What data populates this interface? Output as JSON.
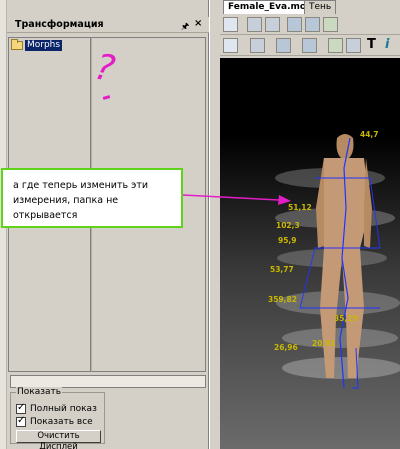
{
  "panel": {
    "title": "Трансформация",
    "pin": "🖈",
    "close": "×",
    "tree": {
      "items": [
        {
          "label": "Morphs",
          "icon": "folder-icon"
        }
      ]
    },
    "show_group": {
      "legend": "Показать",
      "full_label": "Полный показ",
      "full_checked": true,
      "all_label": "Показать все",
      "all_checked": true,
      "clear_button": "Очистить Дисплей"
    }
  },
  "editor": {
    "tabs": [
      {
        "label": "Female_Eva.mod",
        "active": true
      },
      {
        "label": "Тень",
        "active": false
      }
    ],
    "toolbar_text": {
      "t": "T",
      "i": "i"
    },
    "viewport_labels": [
      "44,7",
      "51,12",
      "102,3",
      "95,9",
      "53,77",
      "359,82",
      "35,19",
      "20,91",
      "26,96"
    ]
  },
  "annotation": {
    "callout_text": "а где теперь изменить эти измерения, папка не открывается",
    "question_mark": "?"
  },
  "colors": {
    "selection": "#0a246a",
    "callout_border": "#5fd31a",
    "annotation": "#e31dc6"
  }
}
